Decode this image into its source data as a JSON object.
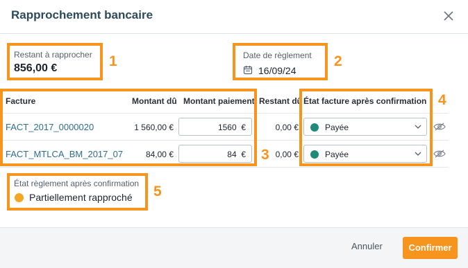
{
  "dialog": {
    "title": "Rapprochement bancaire"
  },
  "summary": {
    "restant_label": "Restant à rapprocher",
    "restant_value": "856,00 €",
    "date_label": "Date de règlement",
    "date_value": "16/09/24"
  },
  "annotations": [
    "1",
    "2",
    "3",
    "4",
    "5"
  ],
  "table": {
    "headers": [
      "Facture",
      "Montant dû",
      "Montant paiement",
      "Restant dû",
      "État facture après confirmation"
    ],
    "rows": [
      {
        "facture": "FACT_2017_0000020",
        "montant_du": "1 560,00 €",
        "paiement": "1560",
        "currency": "€",
        "restant": "0,00 €",
        "etat": "Payée"
      },
      {
        "facture": "FACT_MTLCA_BM_2017_07",
        "montant_du": "84,00 €",
        "paiement": "84",
        "currency": "€",
        "restant": "0,00 €",
        "etat": "Payée"
      }
    ]
  },
  "reglement": {
    "label": "État règlement après confirmation",
    "value": "Partiellement rapproché"
  },
  "footer": {
    "cancel": "Annuler",
    "confirm": "Confirmer"
  },
  "colors": {
    "accent": "#f7941d",
    "status_paid": "#1f8a79",
    "status_partial": "#f5a623"
  }
}
